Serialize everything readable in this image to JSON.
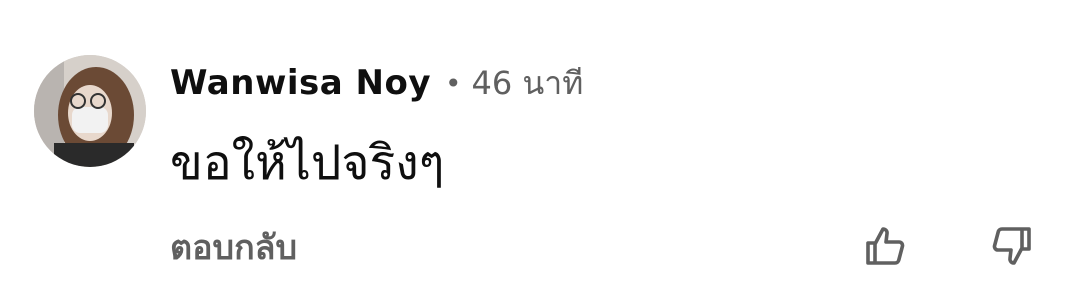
{
  "comment": {
    "author": "Wanwisa Noy",
    "separator": "•",
    "time": "46 นาที",
    "text": "ขอให้ไปจริงๆ",
    "reply_label": "ตอบกลับ"
  },
  "icons": {
    "like": "thumbs-up-icon",
    "dislike": "thumbs-down-icon"
  },
  "colors": {
    "text_primary": "#0f0f0f",
    "text_secondary": "#606060",
    "background": "#ffffff"
  }
}
